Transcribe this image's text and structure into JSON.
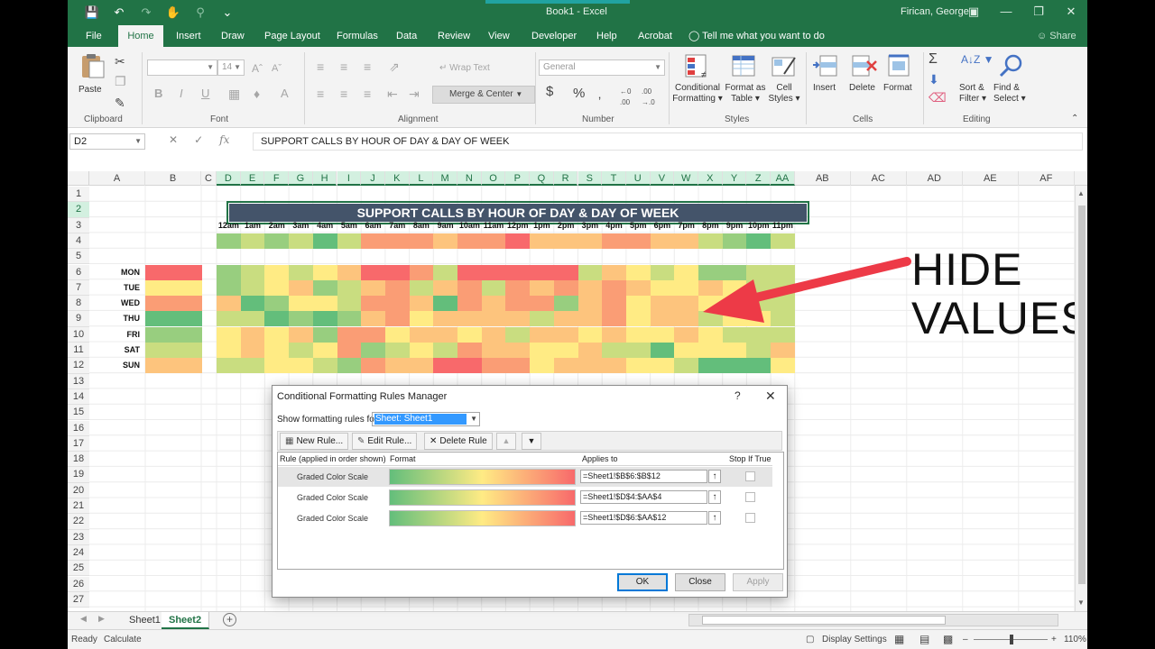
{
  "window": {
    "title": "Book1  -  Excel",
    "user": "Firican, George"
  },
  "ribbon_tabs": [
    "File",
    "Home",
    "Insert",
    "Draw",
    "Page Layout",
    "Formulas",
    "Data",
    "Review",
    "View",
    "Developer",
    "Help",
    "Acrobat"
  ],
  "tell_me": "Tell me what you want to do",
  "share": "Share",
  "ribbon": {
    "clipboard": {
      "paste": "Paste",
      "label": "Clipboard"
    },
    "font": {
      "size": "14",
      "label": "Font"
    },
    "alignment": {
      "wrap": "Wrap Text",
      "merge": "Merge & Center",
      "label": "Alignment"
    },
    "number": {
      "format": "General",
      "label": "Number"
    },
    "styles": {
      "cond1": "Conditional",
      "cond2": "Formatting",
      "fmt1": "Format as",
      "fmt2": "Table",
      "cell1": "Cell",
      "cell2": "Styles",
      "label": "Styles"
    },
    "cells": {
      "insert": "Insert",
      "delete": "Delete",
      "format": "Format",
      "label": "Cells"
    },
    "editing": {
      "sort1": "Sort &",
      "sort2": "Filter",
      "find1": "Find &",
      "find2": "Select",
      "label": "Editing"
    }
  },
  "formula_bar": {
    "name_box": "D2",
    "fx": "fx",
    "content": "SUPPORT CALLS BY HOUR OF DAY & DAY OF WEEK"
  },
  "columns": [
    "A",
    "B",
    "C",
    "D",
    "E",
    "F",
    "G",
    "H",
    "I",
    "J",
    "K",
    "L",
    "M",
    "N",
    "O",
    "P",
    "Q",
    "R",
    "S",
    "T",
    "U",
    "V",
    "W",
    "X",
    "Y",
    "Z",
    "AA",
    "AB",
    "AC",
    "AD",
    "AE",
    "AF"
  ],
  "rows": [
    "1",
    "2",
    "3",
    "4",
    "5",
    "6",
    "7",
    "8",
    "9",
    "10",
    "11",
    "12",
    "13",
    "14",
    "15",
    "16",
    "17",
    "18",
    "19",
    "20",
    "21",
    "22",
    "23",
    "24",
    "25",
    "26",
    "27"
  ],
  "sheet": {
    "banner": "SUPPORT CALLS BY HOUR OF DAY & DAY OF WEEK",
    "hours": [
      "12am",
      "1am",
      "2am",
      "3am",
      "4am",
      "5am",
      "6am",
      "7am",
      "8am",
      "9am",
      "10am",
      "11am",
      "12pm",
      "1pm",
      "2pm",
      "3pm",
      "4pm",
      "5pm",
      "6pm",
      "7pm",
      "8pm",
      "9pm",
      "10pm",
      "11pm"
    ],
    "days": [
      "MON",
      "TUE",
      "WED",
      "THU",
      "FRI",
      "SAT",
      "SUN"
    ],
    "palette": {
      "r": "#f8696b",
      "o": "#fa9d75",
      "a": "#fdc47d",
      "y": "#ffeb84",
      "l": "#c9dd80",
      "m": "#98ce7f",
      "g": "#63be7b"
    },
    "day_totals_colors": [
      "r",
      "y",
      "o",
      "g",
      "m",
      "l",
      "a"
    ],
    "hour_totals_colors": [
      "m",
      "l",
      "m",
      "l",
      "g",
      "l",
      "o",
      "o",
      "o",
      "a",
      "o",
      "o",
      "r",
      "a",
      "a",
      "a",
      "o",
      "o",
      "a",
      "a",
      "l",
      "m",
      "g",
      "l"
    ],
    "heatmap_colors": [
      [
        "m",
        "l",
        "y",
        "l",
        "y",
        "a",
        "r",
        "r",
        "o",
        "l",
        "r",
        "r",
        "r",
        "r",
        "r",
        "l",
        "a",
        "y",
        "l",
        "y",
        "m",
        "m",
        "l",
        "l"
      ],
      [
        "m",
        "l",
        "y",
        "a",
        "m",
        "l",
        "a",
        "o",
        "l",
        "a",
        "o",
        "l",
        "o",
        "a",
        "o",
        "a",
        "o",
        "a",
        "y",
        "y",
        "a",
        "y",
        "l",
        "l"
      ],
      [
        "a",
        "g",
        "m",
        "y",
        "y",
        "l",
        "o",
        "o",
        "a",
        "g",
        "o",
        "a",
        "o",
        "o",
        "m",
        "a",
        "o",
        "y",
        "a",
        "a",
        "y",
        "y",
        "l",
        "l"
      ],
      [
        "l",
        "l",
        "g",
        "m",
        "g",
        "m",
        "a",
        "o",
        "y",
        "a",
        "a",
        "a",
        "a",
        "l",
        "a",
        "a",
        "o",
        "y",
        "a",
        "a",
        "l",
        "y",
        "y",
        "l"
      ],
      [
        "y",
        "a",
        "y",
        "a",
        "m",
        "o",
        "o",
        "y",
        "a",
        "a",
        "y",
        "a",
        "l",
        "a",
        "a",
        "y",
        "a",
        "y",
        "y",
        "a",
        "y",
        "l",
        "l",
        "l"
      ],
      [
        "y",
        "a",
        "y",
        "l",
        "y",
        "o",
        "m",
        "l",
        "y",
        "l",
        "o",
        "a",
        "a",
        "y",
        "y",
        "a",
        "l",
        "l",
        "g",
        "y",
        "y",
        "y",
        "l",
        "a"
      ],
      [
        "l",
        "l",
        "y",
        "y",
        "l",
        "m",
        "o",
        "a",
        "a",
        "r",
        "r",
        "o",
        "o",
        "y",
        "a",
        "a",
        "a",
        "y",
        "y",
        "l",
        "g",
        "g",
        "g",
        "y"
      ]
    ]
  },
  "callout": {
    "line1": "HIDE",
    "line2": "VALUES"
  },
  "sheet_tabs": [
    "Sheet1",
    "Sheet2"
  ],
  "status": {
    "ready": "Ready",
    "calculate": "Calculate",
    "display": "Display Settings",
    "zoom": "110%"
  },
  "dialog": {
    "title": "Conditional Formatting Rules Manager",
    "show_label": "Show formatting rules for:",
    "show_value": "Sheet: Sheet1",
    "buttons": {
      "new": "New Rule...",
      "edit": "Edit Rule...",
      "delete": "Delete Rule"
    },
    "headers": {
      "rule": "Rule (applied in order shown)",
      "format": "Format",
      "applies": "Applies to",
      "stop": "Stop If True"
    },
    "rules": [
      {
        "name": "Graded Color Scale",
        "scale": "green-yellow-red",
        "applies": "=Sheet1!$B$6:$B$12"
      },
      {
        "name": "Graded Color Scale",
        "scale": "green-yellow-red",
        "applies": "=Sheet1!$D$4:$AA$4"
      },
      {
        "name": "Graded Color Scale",
        "scale": "green-yellow-red",
        "applies": "=Sheet1!$D$6:$AA$12"
      }
    ],
    "ok": "OK",
    "close": "Close",
    "apply": "Apply"
  }
}
